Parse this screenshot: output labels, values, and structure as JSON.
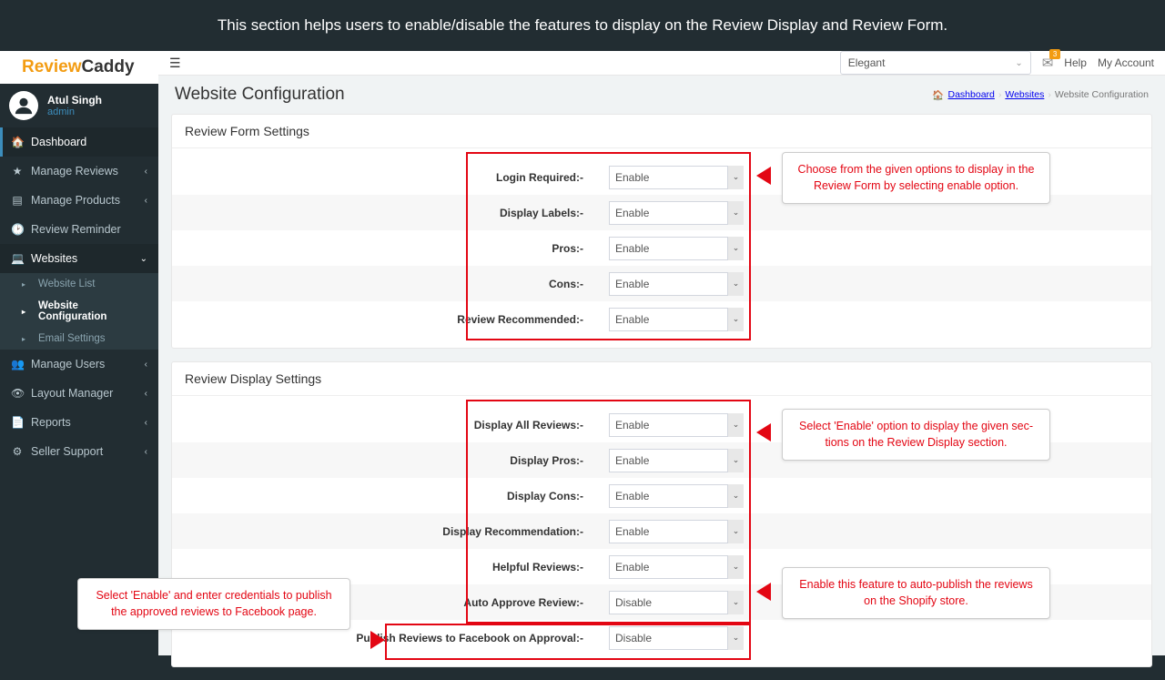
{
  "banner": "This section helps users to enable/disable the features to display on the Review Display and Review Form.",
  "logo": {
    "part1": "Review",
    "part2": "Caddy"
  },
  "user": {
    "name": "Atul Singh",
    "role": "admin"
  },
  "nav": {
    "dashboard": "Dashboard",
    "manage_reviews": "Manage Reviews",
    "manage_products": "Manage Products",
    "review_reminder": "Review Reminder",
    "websites": "Websites",
    "website_list": "Website List",
    "website_config": "Website Configuration",
    "email_settings": "Email Settings",
    "manage_users": "Manage Users",
    "layout_manager": "Layout Manager",
    "reports": "Reports",
    "seller_support": "Seller Support"
  },
  "topbar": {
    "theme": "Elegant",
    "badge": "3",
    "help": "Help",
    "account": "My Account"
  },
  "page": {
    "title": "Website Configuration",
    "crumb1": "Dashboard",
    "crumb2": "Websites",
    "crumb3": "Website Configuration"
  },
  "panel1": {
    "title": "Review Form Settings",
    "rows": {
      "login": {
        "label": "Login Required:-",
        "value": "Enable"
      },
      "labels": {
        "label": "Display Labels:-",
        "value": "Enable"
      },
      "pros": {
        "label": "Pros:-",
        "value": "Enable"
      },
      "cons": {
        "label": "Cons:-",
        "value": "Enable"
      },
      "recommend": {
        "label": "Review Recommended:-",
        "value": "Enable"
      }
    }
  },
  "panel2": {
    "title": "Review Display Settings",
    "rows": {
      "all": {
        "label": "Display All Reviews:-",
        "value": "Enable"
      },
      "pros": {
        "label": "Display Pros:-",
        "value": "Enable"
      },
      "cons": {
        "label": "Display Cons:-",
        "value": "Enable"
      },
      "rec": {
        "label": "Display Recommendation:-",
        "value": "Enable"
      },
      "helpful": {
        "label": "Helpful Reviews:-",
        "value": "Enable"
      },
      "auto": {
        "label": "Auto Approve Review:-",
        "value": "Disable"
      },
      "fb": {
        "label": "Publish Reviews to Facebook on Approval:-",
        "value": "Disable"
      }
    }
  },
  "callouts": {
    "c1": "Choose from the given options to display in the Review Form by selecting enable option.",
    "c2": "Select 'Enable' option to display the given sec­tions on the Review Display section.",
    "c3": "Enable this feature to auto-publish the reviews on the Shopify store.",
    "c4": "Select 'Enable' and enter credentials to publish the approved reviews to Facebook page."
  }
}
